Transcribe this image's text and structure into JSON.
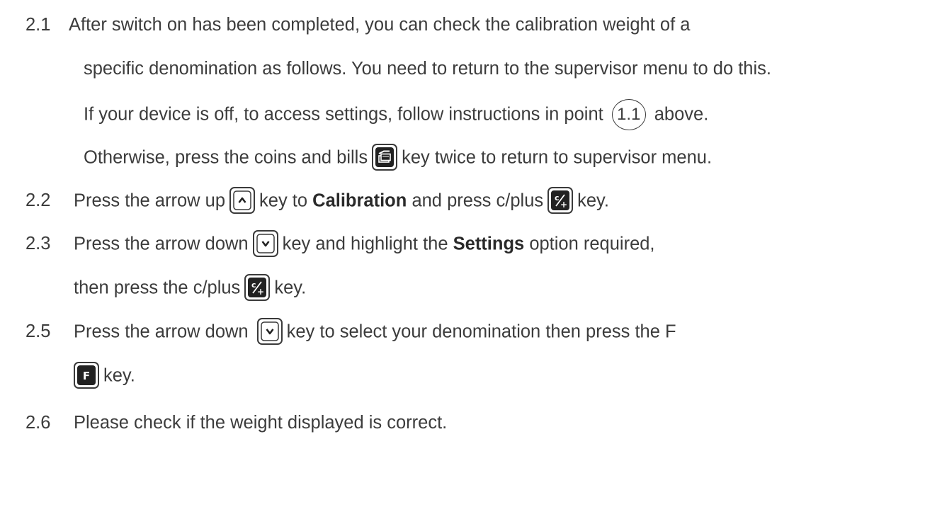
{
  "steps": [
    {
      "number": "2.1",
      "lines": [
        [
          "After switch on has been completed, you can check the calibration weight of a"
        ],
        [
          "specific denomination as follows. You need to return to the supervisor menu to do this."
        ],
        [
          "If your device is off, to access settings, follow instructions in point",
          "1.1",
          "above."
        ],
        [
          "Otherwise, press the coins and bills",
          "key twice to return to supervisor menu."
        ]
      ]
    },
    {
      "number": "2.2",
      "lines": [
        [
          "Press the arrow up",
          "key to",
          "Calibration",
          "and press c/plus",
          "key."
        ]
      ]
    },
    {
      "number": "2.3",
      "lines": [
        [
          "Press the arrow down",
          "key and highlight the",
          "Settings",
          "option required,"
        ],
        [
          "then press the c/plus",
          "key."
        ]
      ]
    },
    {
      "number": "2.5",
      "lines": [
        [
          "Press the arrow down",
          "key to select your denomination then press the F"
        ],
        [
          "key."
        ]
      ]
    },
    {
      "number": "2.6",
      "lines": [
        [
          "Please check if the weight displayed is correct."
        ]
      ]
    }
  ],
  "icons": {
    "coins_bills": "coins-and-bills-key",
    "arrow_up": "arrow-up-key",
    "arrow_down": "arrow-down-key",
    "c_plus": "c-plus-key",
    "f_key": "f-key"
  },
  "key_labels": {
    "c_plus_c": "c",
    "c_plus_plus": "+",
    "f": "F"
  }
}
